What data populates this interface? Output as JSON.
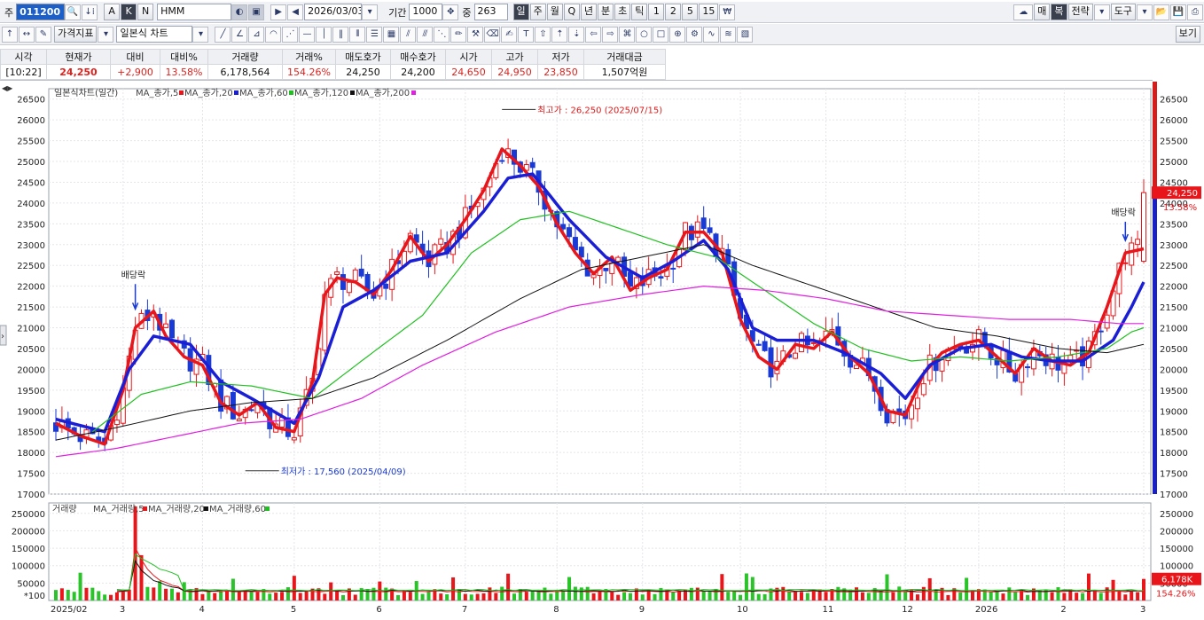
{
  "toolbar1": {
    "prefix": "주",
    "code": "011200",
    "type_btns": [
      "A",
      "K",
      "N"
    ],
    "name": "HMM",
    "date": "2026/03/03",
    "period_label": "기간",
    "period_value": "1000",
    "count_label": "중",
    "count_value": "263",
    "periods": [
      "일",
      "주",
      "월",
      "Q",
      "년",
      "분",
      "초",
      "틱",
      "1",
      "2",
      "5",
      "15"
    ],
    "right_btns": [
      "매",
      "복",
      "전략",
      "도구",
      "보기"
    ]
  },
  "toolbar2": {
    "indicator_btn": "가격지표",
    "chart_type": "일본식 차트"
  },
  "quote": {
    "headers": [
      "시각",
      "현재가",
      "대비",
      "대비%",
      "거래량",
      "거래%",
      "매도호가",
      "매수호가",
      "시가",
      "고가",
      "저가",
      "거래대금"
    ],
    "values": [
      "[10:22]",
      "24,250",
      "+2,900",
      "13.58%",
      "6,178,564",
      "154.26%",
      "24,250",
      "24,200",
      "24,650",
      "24,950",
      "23,850",
      "1,507억원"
    ]
  },
  "price_legend": [
    {
      "text": "일본식차트(일간)",
      "color": "#333333"
    },
    {
      "text": "MA_종가,5",
      "color": "#e8161a"
    },
    {
      "text": "MA_종가,20",
      "color": "#1a1fd6"
    },
    {
      "text": "MA_종가,60",
      "color": "#20c020"
    },
    {
      "text": "MA_종가,120",
      "color": "#111111"
    },
    {
      "text": "MA_종가,200",
      "color": "#e020e0"
    }
  ],
  "volume_legend": [
    {
      "text": "거래량",
      "color": "#333333"
    },
    {
      "text": "MA_거래량,5",
      "color": "#e8161a"
    },
    {
      "text": "MA_거래량,20",
      "color": "#111111"
    },
    {
      "text": "MA_거래량,60",
      "color": "#20c020"
    }
  ],
  "annotations": {
    "high": "최고가 : 26,250 (2025/07/15)",
    "low": "최저가 : 17,560 (2025/04/09)",
    "ex_div1": "배당락",
    "ex_div2": "배당락",
    "last_price": "24,250",
    "last_pct": "13.58%",
    "vol_last": "6,178K",
    "vol_pct": "154.26%",
    "vol_unit": "*100"
  },
  "chart_data": {
    "type": "candlestick",
    "price_ylim": [
      17000,
      26750
    ],
    "price_ticks": [
      17000,
      17500,
      18000,
      18500,
      19000,
      19500,
      20000,
      20500,
      21000,
      21500,
      22000,
      22500,
      23000,
      23500,
      24000,
      24500,
      25000,
      25500,
      26000,
      26500
    ],
    "volume_ylim": [
      0,
      280000
    ],
    "volume_ticks": [
      50000,
      100000,
      150000,
      200000,
      250000
    ],
    "x_labels": [
      "2025/02",
      "3",
      "4",
      "5",
      "6",
      "7",
      "8",
      "9",
      "10",
      "11",
      "12",
      "2026",
      "2",
      "3"
    ],
    "series": [
      {
        "name": "MA_종가,5",
        "anchors": [
          [
            0,
            18700
          ],
          [
            4,
            18400
          ],
          [
            8,
            18200
          ],
          [
            11,
            19500
          ],
          [
            13,
            21000
          ],
          [
            16,
            21400
          ],
          [
            18,
            20800
          ],
          [
            21,
            20300
          ],
          [
            24,
            20100
          ],
          [
            27,
            19200
          ],
          [
            30,
            18900
          ],
          [
            33,
            19200
          ],
          [
            36,
            18600
          ],
          [
            39,
            18500
          ],
          [
            42,
            19700
          ],
          [
            44,
            21800
          ],
          [
            46,
            22200
          ],
          [
            49,
            22100
          ],
          [
            52,
            21800
          ],
          [
            55,
            22400
          ],
          [
            58,
            23200
          ],
          [
            61,
            22600
          ],
          [
            64,
            23000
          ],
          [
            67,
            23600
          ],
          [
            70,
            24300
          ],
          [
            73,
            25300
          ],
          [
            76,
            24900
          ],
          [
            79,
            24400
          ],
          [
            82,
            23500
          ],
          [
            85,
            22800
          ],
          [
            88,
            22300
          ],
          [
            91,
            22700
          ],
          [
            94,
            21900
          ],
          [
            97,
            22200
          ],
          [
            100,
            22400
          ],
          [
            103,
            23300
          ],
          [
            106,
            23300
          ],
          [
            109,
            22800
          ],
          [
            112,
            21200
          ],
          [
            115,
            20300
          ],
          [
            118,
            20000
          ],
          [
            121,
            20600
          ],
          [
            124,
            20500
          ],
          [
            127,
            20900
          ],
          [
            130,
            20300
          ],
          [
            133,
            19900
          ],
          [
            136,
            19000
          ],
          [
            139,
            18900
          ],
          [
            142,
            19900
          ],
          [
            145,
            20400
          ],
          [
            148,
            20600
          ],
          [
            151,
            20700
          ],
          [
            154,
            20300
          ],
          [
            157,
            19900
          ],
          [
            160,
            20500
          ],
          [
            163,
            20200
          ],
          [
            166,
            20100
          ],
          [
            169,
            20400
          ],
          [
            172,
            21500
          ],
          [
            175,
            22800
          ],
          [
            178,
            22900
          ]
        ]
      },
      {
        "name": "MA_종가,20",
        "anchors": [
          [
            0,
            18800
          ],
          [
            8,
            18500
          ],
          [
            12,
            20000
          ],
          [
            16,
            20800
          ],
          [
            22,
            20600
          ],
          [
            27,
            19700
          ],
          [
            32,
            19300
          ],
          [
            39,
            18700
          ],
          [
            43,
            19800
          ],
          [
            47,
            21500
          ],
          [
            52,
            21900
          ],
          [
            58,
            22600
          ],
          [
            64,
            22800
          ],
          [
            70,
            23800
          ],
          [
            74,
            24600
          ],
          [
            78,
            24700
          ],
          [
            84,
            23600
          ],
          [
            90,
            22700
          ],
          [
            96,
            22200
          ],
          [
            101,
            22600
          ],
          [
            106,
            23100
          ],
          [
            110,
            22400
          ],
          [
            114,
            21000
          ],
          [
            118,
            20700
          ],
          [
            124,
            20700
          ],
          [
            129,
            20400
          ],
          [
            135,
            19900
          ],
          [
            139,
            19300
          ],
          [
            143,
            20100
          ],
          [
            148,
            20500
          ],
          [
            153,
            20600
          ],
          [
            158,
            20300
          ],
          [
            163,
            20200
          ],
          [
            168,
            20200
          ],
          [
            173,
            20700
          ],
          [
            176,
            21500
          ],
          [
            178,
            22100
          ]
        ]
      },
      {
        "name": "MA_종가,60",
        "anchors": [
          [
            6,
            18500
          ],
          [
            14,
            19400
          ],
          [
            22,
            19700
          ],
          [
            32,
            19600
          ],
          [
            42,
            19300
          ],
          [
            50,
            20200
          ],
          [
            60,
            21300
          ],
          [
            68,
            22800
          ],
          [
            76,
            23600
          ],
          [
            84,
            23800
          ],
          [
            92,
            23400
          ],
          [
            100,
            23000
          ],
          [
            108,
            22700
          ],
          [
            116,
            21900
          ],
          [
            124,
            21100
          ],
          [
            132,
            20500
          ],
          [
            140,
            20200
          ],
          [
            148,
            20300
          ],
          [
            156,
            20200
          ],
          [
            164,
            20300
          ],
          [
            172,
            20500
          ],
          [
            176,
            20900
          ],
          [
            178,
            21000
          ]
        ]
      },
      {
        "name": "MA_종가,120",
        "anchors": [
          [
            0,
            18300
          ],
          [
            10,
            18600
          ],
          [
            22,
            19000
          ],
          [
            32,
            19200
          ],
          [
            42,
            19300
          ],
          [
            52,
            19800
          ],
          [
            64,
            20700
          ],
          [
            76,
            21700
          ],
          [
            86,
            22400
          ],
          [
            96,
            22700
          ],
          [
            106,
            23000
          ],
          [
            114,
            22500
          ],
          [
            124,
            22000
          ],
          [
            134,
            21500
          ],
          [
            144,
            21000
          ],
          [
            154,
            20800
          ],
          [
            164,
            20500
          ],
          [
            172,
            20400
          ],
          [
            178,
            20600
          ]
        ]
      },
      {
        "name": "MA_종가,200",
        "anchors": [
          [
            0,
            17900
          ],
          [
            10,
            18100
          ],
          [
            20,
            18400
          ],
          [
            30,
            18700
          ],
          [
            40,
            18800
          ],
          [
            50,
            19300
          ],
          [
            60,
            20100
          ],
          [
            72,
            20900
          ],
          [
            84,
            21500
          ],
          [
            96,
            21800
          ],
          [
            106,
            22000
          ],
          [
            116,
            21900
          ],
          [
            126,
            21700
          ],
          [
            136,
            21400
          ],
          [
            146,
            21300
          ],
          [
            156,
            21200
          ],
          [
            166,
            21200
          ],
          [
            174,
            21100
          ],
          [
            178,
            21100
          ]
        ]
      }
    ],
    "notes": "Candle and volume bars are generated procedurally around MA_종가,5 anchors; highlighted points: high 26,250 (2025/07/15), low 17,560 (2025/04/09), last 24,250."
  }
}
